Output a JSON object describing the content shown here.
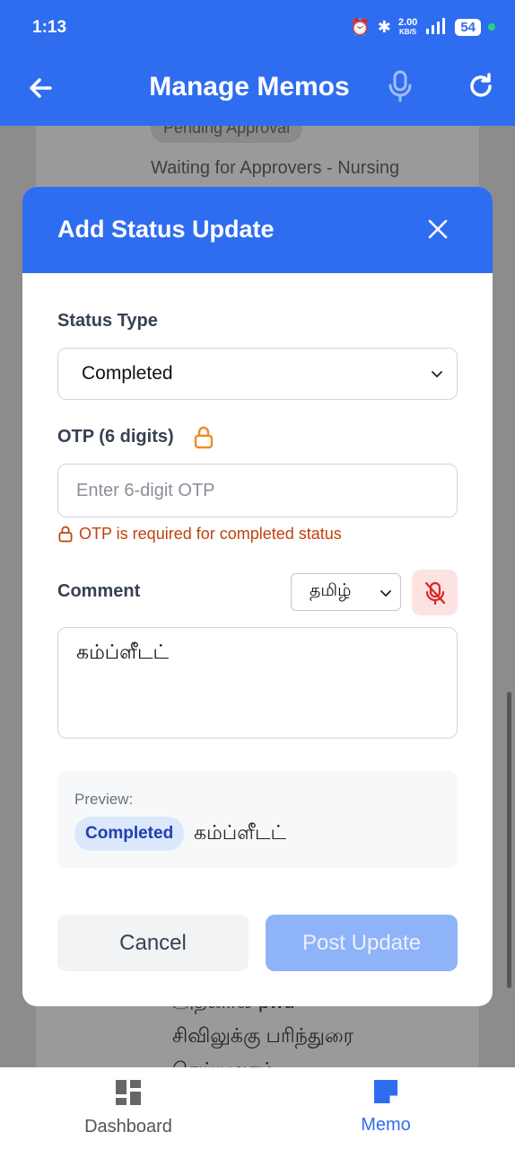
{
  "status_bar": {
    "time": "1:13",
    "net_speed_top": "2.00",
    "net_speed_bottom": "KB/S",
    "battery": "54"
  },
  "header": {
    "title": "Manage Memos"
  },
  "background": {
    "badge": "Pending Approval",
    "line": "Waiting for Approvers - Nursing",
    "tamil_1": "அதனால் pwd",
    "tamil_2": "சிவிலுக்கு பரிந்துரை",
    "tamil_3": "செய்யலாம்"
  },
  "modal": {
    "title": "Add Status Update",
    "status_type_label": "Status Type",
    "status_type_value": "Completed",
    "otp_label": "OTP (6 digits)",
    "otp_placeholder": "Enter 6-digit OTP",
    "otp_hint": "OTP is required for completed status",
    "comment_label": "Comment",
    "language_value": "தமிழ்",
    "comment_value": "கம்ப்ளீடட்",
    "preview_label": "Preview:",
    "preview_badge": "Completed",
    "preview_text": "கம்ப்ளீடட்",
    "cancel_label": "Cancel",
    "post_label": "Post Update"
  },
  "bottom_nav": {
    "dashboard_label": "Dashboard",
    "memo_label": "Memo"
  },
  "colors": {
    "primary": "#2f6df0",
    "warning": "#c2410c",
    "mic_off_bg": "#fde2e2"
  }
}
